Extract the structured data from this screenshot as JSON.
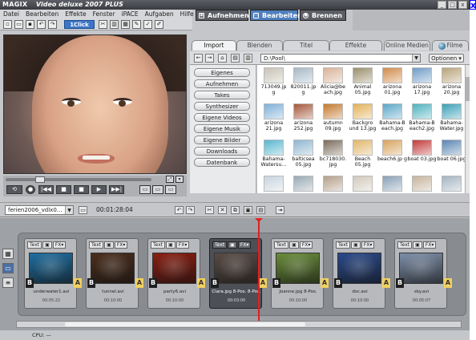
{
  "window": {
    "logo": "MAGIX",
    "title": "Video deluxe 2007 PLUS",
    "controls": [
      "_",
      "□",
      "x"
    ],
    "external_close": "x"
  },
  "menu": [
    "Datei",
    "Bearbeiten",
    "Effekte",
    "Fenster",
    "iPACE",
    "Aufgaben",
    "Hilfe"
  ],
  "toolbar": {
    "oneclick_label": "1Click"
  },
  "mode_tabs": [
    {
      "label": "Aufnehmen"
    },
    {
      "label": "Bearbeiten"
    },
    {
      "label": "Brennen"
    }
  ],
  "transport": {
    "buttons": [
      "⟲",
      "●",
      "|◀◀",
      "■",
      "■",
      "▶",
      "▶▶|"
    ]
  },
  "media_tabs": [
    {
      "label": "Import"
    },
    {
      "label": "Blenden"
    },
    {
      "label": "Titel"
    },
    {
      "label": "Effekte"
    },
    {
      "label": "Online Medien"
    },
    {
      "label": "Filme"
    }
  ],
  "filebar": {
    "path": "D:\\Pool\\",
    "options_label": "Optionen"
  },
  "nav_buttons": [
    "Eigenes",
    "Aufnehmen",
    "Takes",
    "Synthesizer",
    "Eigene Videos",
    "Eigene Musik",
    "Eigene Bilder",
    "Downloads",
    "Datenbank"
  ],
  "files": [
    {
      "name": "713049.jp g",
      "color": "#c8c2b6"
    },
    {
      "name": "820011.jp g",
      "color": "#a7b8c6"
    },
    {
      "name": "Alicia@be ach.jpg",
      "color": "#d9b39a"
    },
    {
      "name": "Animal 05.jpg",
      "color": "#9a8f6a"
    },
    {
      "name": "arizona 01.jpg",
      "color": "#d08a4a"
    },
    {
      "name": "arizona 17.jpg",
      "color": "#6f9cc7"
    },
    {
      "name": "arizona 20.jpg",
      "color": "#b9a37a"
    },
    {
      "name": "arizona 21.jpg",
      "color": "#7fb0d8"
    },
    {
      "name": "arizona 252.jpg",
      "color": "#a4583a"
    },
    {
      "name": "autumn 09.jpg",
      "color": "#c47a2e"
    },
    {
      "name": "Backgro und 13.jpg",
      "color": "#e2b25a"
    },
    {
      "name": "Bahama-B each.jpg",
      "color": "#5aa7c7"
    },
    {
      "name": "Bahama-B each2.jpg",
      "color": "#4db2bd"
    },
    {
      "name": "Bahama-Water.jpg",
      "color": "#3aa0b8"
    },
    {
      "name": "Bahama-Watersu...",
      "color": "#58b6cf"
    },
    {
      "name": "balticsea 05.jpg",
      "color": "#8fb6d0"
    },
    {
      "name": "bc718030. jpg",
      "color": "#7a6a5a"
    },
    {
      "name": "Beach 05.jpg",
      "color": "#e0b66a"
    },
    {
      "name": "beach6.jp g",
      "color": "#d8a45c"
    },
    {
      "name": "boat 03.jpg",
      "color": "#c23a3a"
    },
    {
      "name": "boat 06.jpg",
      "color": "#5b86b3"
    },
    {
      "name": "",
      "color": "#c8d4de"
    },
    {
      "name": "",
      "color": "#9aa9b4"
    },
    {
      "name": "",
      "color": "#b4a08a"
    },
    {
      "name": "",
      "color": "#d1c9bb"
    },
    {
      "name": "",
      "color": "#8aa0b7"
    },
    {
      "name": "",
      "color": "#c6b49d"
    },
    {
      "name": "",
      "color": "#a5b5c2"
    }
  ],
  "project": {
    "name": "ferien2006_vdlx0...",
    "timecode": "00:01:28:04"
  },
  "clips": [
    {
      "name": "underwater1.avi",
      "duration": "00:05:22",
      "color": "#1f6ea0",
      "selected": false,
      "icon": "▣"
    },
    {
      "name": "tunnel.avi",
      "duration": "00:10:00",
      "color": "#4a2e1c",
      "selected": false,
      "icon": "▣"
    },
    {
      "name": "party6.avi",
      "duration": "00:10:00",
      "color": "#8a1e12",
      "selected": false,
      "icon": "▣"
    },
    {
      "name": "Clara.jpg 8-Pos. 8-Pos.",
      "duration": "00:03:00",
      "color": "#5a4c46",
      "selected": true,
      "icon": "▣"
    },
    {
      "name": "Joanne.jpg 8-Pos.",
      "duration": "00:10:00",
      "color": "#6a8d3a",
      "selected": false,
      "icon": "▣"
    },
    {
      "name": "dsc.avi",
      "duration": "00:10:00",
      "color": "#2a4a8a",
      "selected": false,
      "icon": "▣"
    },
    {
      "name": "sky.avi",
      "duration": "00:05:07",
      "color": "#7d8fa8",
      "selected": false,
      "icon": "▣"
    }
  ],
  "clip_buttons": {
    "text": "Text",
    "fx": "FX"
  },
  "transitions": {
    "b": "B",
    "a": "A"
  },
  "status": {
    "cpu_label": "CPU: —"
  }
}
